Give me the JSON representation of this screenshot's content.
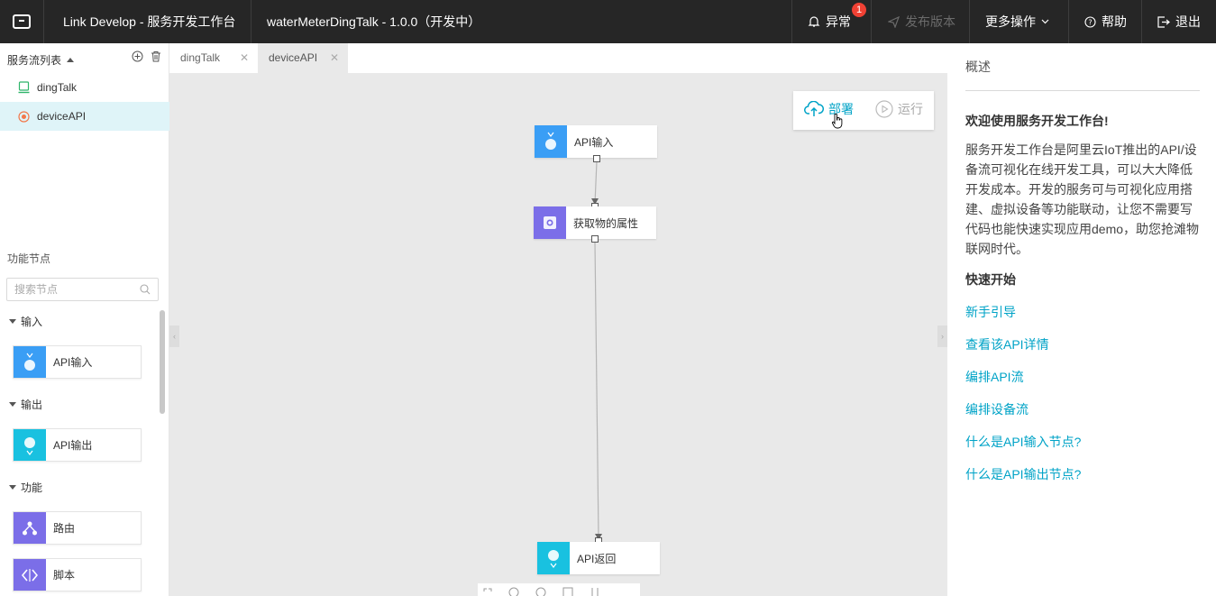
{
  "topbar": {
    "app_title": "Link Develop - 服务开发工作台",
    "project_title": "waterMeterDingTalk - 1.0.0（开发中）",
    "alert_label": "异常",
    "alert_count": "1",
    "publish_label": "发布版本",
    "more_label": "更多操作",
    "help_label": "帮助",
    "logout_label": "退出"
  },
  "sidebar": {
    "flows_title": "服务流列表",
    "flows": [
      {
        "label": "dingTalk",
        "icon": "device-icon"
      },
      {
        "label": "deviceAPI",
        "icon": "api-target-icon"
      }
    ],
    "nodes_title": "功能节点",
    "search_placeholder": "搜索节点",
    "categories": [
      {
        "label": "输入",
        "nodes": [
          {
            "label": "API输入",
            "color": "#3a9ef5"
          }
        ]
      },
      {
        "label": "输出",
        "nodes": [
          {
            "label": "API输出",
            "color": "#19c1e0"
          }
        ]
      },
      {
        "label": "功能",
        "nodes": [
          {
            "label": "路由",
            "color": "#7b6ee8"
          },
          {
            "label": "脚本",
            "color": "#7b6ee8"
          }
        ]
      }
    ]
  },
  "tabs": [
    {
      "label": "dingTalk",
      "active": false
    },
    {
      "label": "deviceAPI",
      "active": true
    }
  ],
  "canvas": {
    "deploy_label": "部署",
    "run_label": "运行",
    "nodes": [
      {
        "label": "API输入",
        "color": "#3a9ef5"
      },
      {
        "label": "获取物的属性",
        "color": "#7b6ee8"
      },
      {
        "label": "API返回",
        "color": "#19c1e0"
      }
    ]
  },
  "panel": {
    "title": "概述",
    "welcome": "欢迎使用服务开发工作台!",
    "description": "服务开发工作台是阿里云IoT推出的API/设备流可视化在线开发工具，可以大大降低开发成本。开发的服务可与可视化应用搭建、虚拟设备等功能联动，让您不需要写代码也能快速实现应用demo，助您抢滩物联网时代。",
    "quick_start": "快速开始",
    "links": [
      "新手引导",
      "查看该API详情",
      "编排API流",
      "编排设备流",
      "什么是API输入节点?",
      "什么是API输出节点?"
    ]
  },
  "colors": {
    "accent": "#00a3c7",
    "topbar": "#262626",
    "badge": "#f04134"
  }
}
